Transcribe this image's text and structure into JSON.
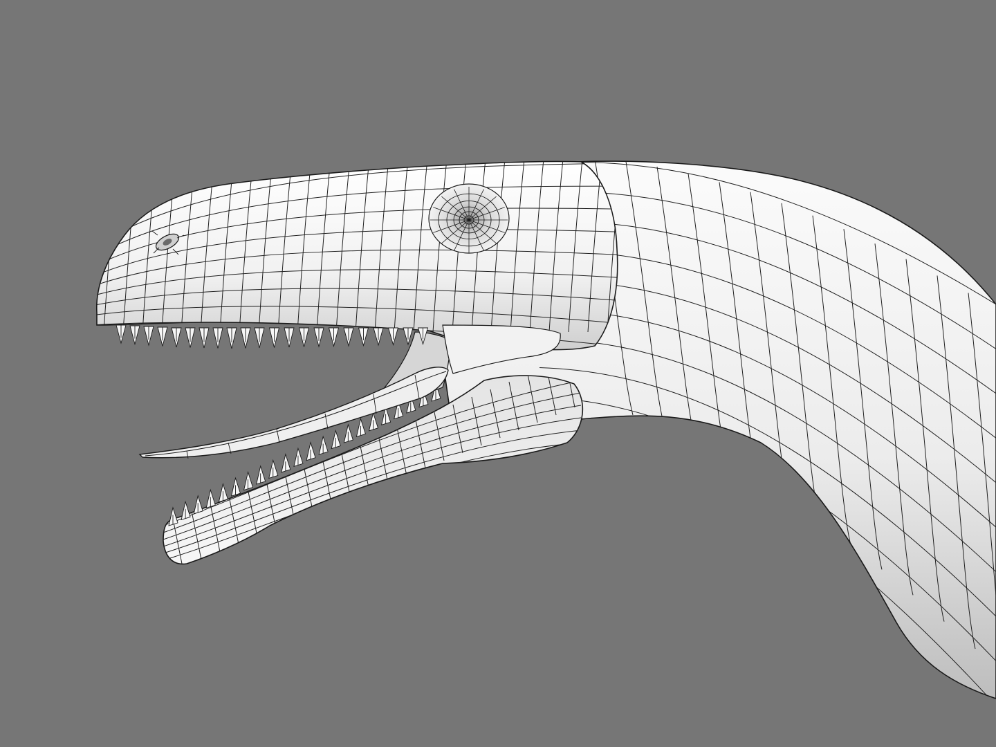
{
  "viewport": {
    "background_color": "#767676",
    "render_style": "wireframe-on-shaded",
    "model": {
      "subject": "dinosaur-head-and-neck",
      "surface_color": "#f4f4f4",
      "shadow_color": "#bdbdbd",
      "wire_color": "#1a1a1a",
      "mouth_state": "open",
      "visible_parts": [
        "neck",
        "skull",
        "eye-socket",
        "nostril",
        "upper-jaw-teeth",
        "tongue",
        "lower-jaw",
        "lower-jaw-teeth"
      ]
    }
  }
}
